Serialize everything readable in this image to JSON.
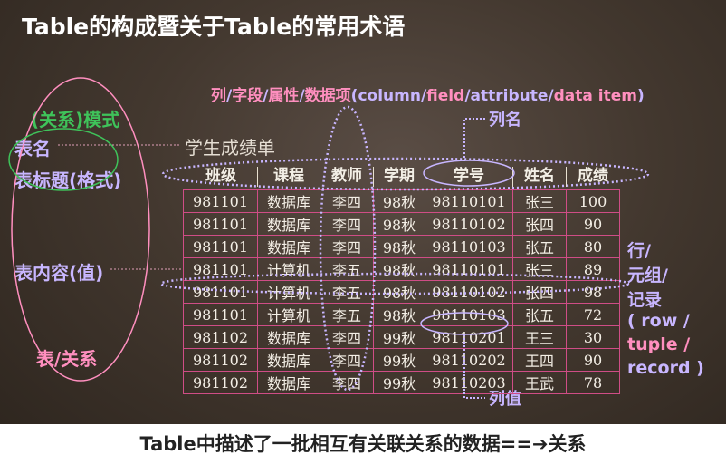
{
  "title": "Table的构成暨关于Table的常用术语",
  "column_terms": {
    "part1": "列",
    "sep1": "/",
    "part2": "字段",
    "sep2": "/",
    "part3": "属性",
    "sep3": "/",
    "part4": "数据项",
    "paren_open": "(",
    "e1": "column",
    "esep1": "/",
    "e2": "field",
    "esep2": "/",
    "e3": "attribute",
    "esep3": "/",
    "e4": "data item",
    "paren_close": ")"
  },
  "labels": {
    "schema": "(关系)模式",
    "table_name": "表名",
    "table_header": "表标题(格式)",
    "table_content": "表内容(值)",
    "table_relation": "表/关系",
    "column_name": "列名",
    "column_value": "列值",
    "row_line1": "行/",
    "row_line2": "元组/",
    "row_line3": "记录",
    "row_line4": "( row /",
    "row_line5": "tuple /",
    "row_line6": "record )"
  },
  "table": {
    "name": "学生成绩单",
    "headers": [
      "班级",
      "课程",
      "教师",
      "学期",
      "学号",
      "姓名",
      "成绩"
    ],
    "rows": [
      [
        "981101",
        "数据库",
        "李四",
        "98秋",
        "98110101",
        "张三",
        "100"
      ],
      [
        "981101",
        "数据库",
        "李四",
        "98秋",
        "98110102",
        "张四",
        "90"
      ],
      [
        "981101",
        "数据库",
        "李四",
        "98秋",
        "98110103",
        "张五",
        "80"
      ],
      [
        "981101",
        "计算机",
        "李五",
        "98秋",
        "98110101",
        "张三",
        "89"
      ],
      [
        "981101",
        "计算机",
        "李五",
        "98秋",
        "98110102",
        "张四",
        "98"
      ],
      [
        "981101",
        "计算机",
        "李五",
        "98秋",
        "98110103",
        "张五",
        "72"
      ],
      [
        "981102",
        "数据库",
        "李四",
        "99秋",
        "98110201",
        "王三",
        "30"
      ],
      [
        "981102",
        "数据库",
        "李四",
        "99秋",
        "98110202",
        "王四",
        "90"
      ],
      [
        "981102",
        "数据库",
        "李四",
        "99秋",
        "98110203",
        "王武",
        "78"
      ]
    ]
  },
  "bottom": "Table中描述了一批相互有关联关系的数据==➔关系",
  "colors": {
    "pink": "#ff8fbf",
    "lavender": "#c8b6ff",
    "green": "#3fc35a",
    "white": "#ffffff",
    "table_border": "#cf4d86"
  }
}
